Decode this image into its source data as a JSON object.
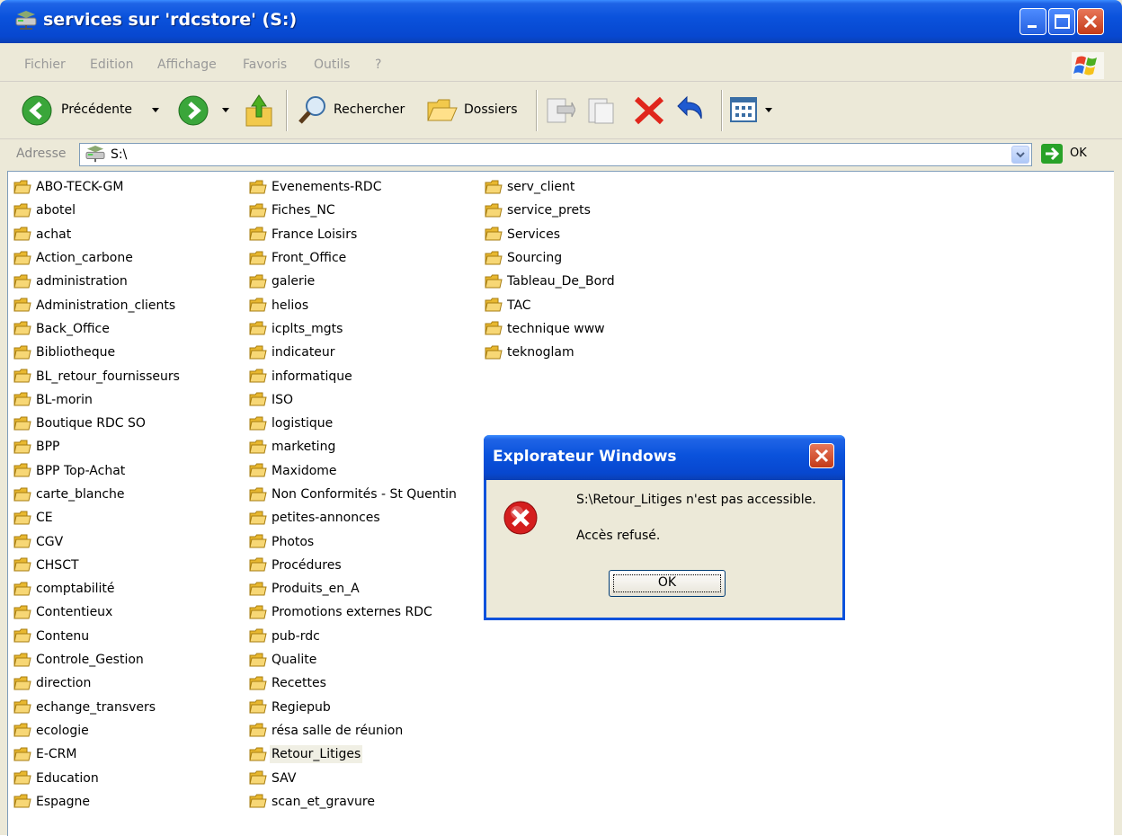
{
  "window": {
    "title": "services sur 'rdcstore' (S:)"
  },
  "menu": [
    "Fichier",
    "Edition",
    "Affichage",
    "Favoris",
    "Outils",
    "?"
  ],
  "toolbar": {
    "back_label": "Précédente",
    "search_label": "Rechercher",
    "folders_label": "Dossiers"
  },
  "address": {
    "label": "Adresse",
    "value": "S:\\",
    "go_label": "OK"
  },
  "folders": {
    "col1": [
      "ABO-TECK-GM",
      "abotel",
      "achat",
      "Action_carbone",
      "administration",
      "Administration_clients",
      "Back_Office",
      "Bibliotheque",
      "BL_retour_fournisseurs",
      "BL-morin",
      "Boutique RDC SO",
      "BPP",
      "BPP Top-Achat",
      "carte_blanche",
      "CE",
      "CGV",
      "CHSCT",
      "comptabilité",
      "Contentieux",
      "Contenu",
      "Controle_Gestion",
      "direction",
      "echange_transvers",
      "ecologie",
      "E-CRM",
      "Education",
      "Espagne"
    ],
    "col2": [
      "Evenements-RDC",
      "Fiches_NC",
      "France Loisirs",
      "Front_Office",
      "galerie",
      "helios",
      "icplts_mgts",
      "indicateur",
      "informatique",
      "ISO",
      "logistique",
      "marketing",
      "Maxidome",
      "Non Conformités - St Quentin",
      "petites-annonces",
      "Photos",
      "Procédures",
      "Produits_en_A",
      "Promotions externes RDC",
      "pub-rdc",
      "Qualite",
      "Recettes",
      "Regiepub",
      "résa salle de réunion",
      "Retour_Litiges",
      "SAV",
      "scan_et_gravure"
    ],
    "col3": [
      "serv_client",
      "service_prets",
      "Services",
      "Sourcing",
      "Tableau_De_Bord",
      "TAC",
      "technique www",
      "teknoglam"
    ],
    "selected": "Retour_Litiges"
  },
  "dialog": {
    "title": "Explorateur Windows",
    "message": "S:\\Retour_Litiges n'est pas accessible.",
    "detail": "Accès refusé.",
    "ok_label": "OK"
  },
  "colors": {
    "titlebar": "#0a52dc",
    "close_button": "#c33a18",
    "folder": "#f2c94c",
    "error_icon": "#d41e1e"
  }
}
